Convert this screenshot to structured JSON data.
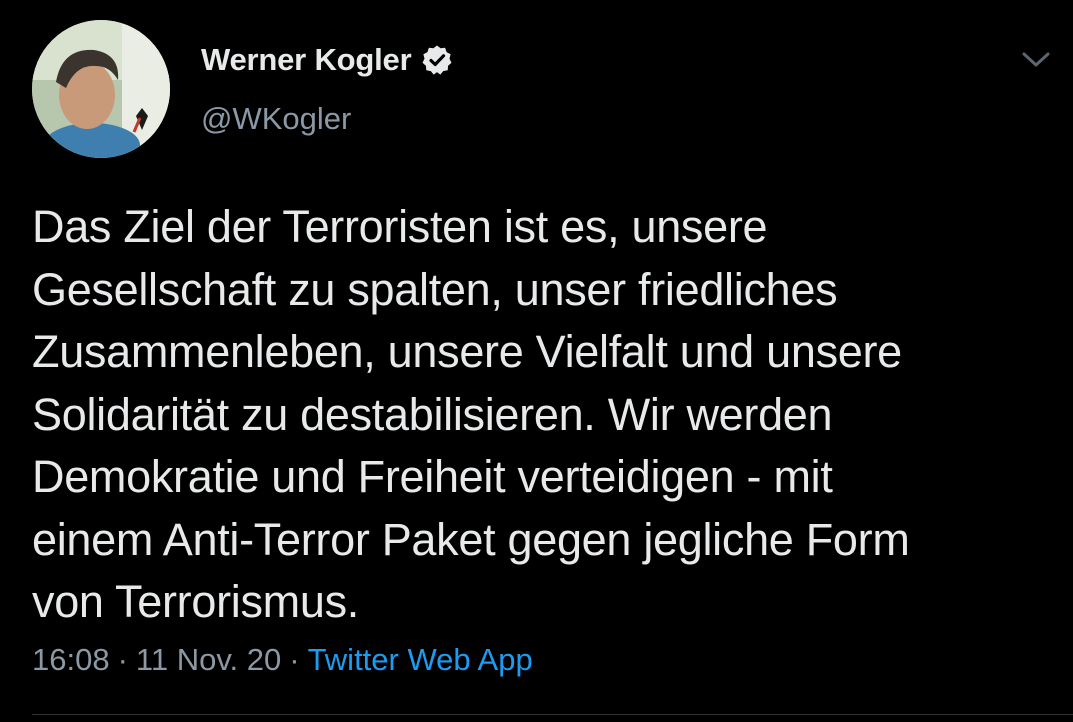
{
  "author": {
    "display_name": "Werner Kogler",
    "handle": "@WKogler",
    "verified": true,
    "avatar_icon": "profile-photo-icon",
    "verified_icon": "verified-badge-icon"
  },
  "menu": {
    "icon": "chevron-down-icon"
  },
  "tweet": {
    "text": "Das Ziel der Terroristen ist es, unsere\nGesellschaft zu spalten, unser friedliches\nZusammenleben, unsere Vielfalt und unsere\nSolidarität zu destabilisieren. Wir werden\nDemokratie und Freiheit verteidigen - mit\neinem Anti-Terror Paket gegen jegliche Form\nvon Terrorismus."
  },
  "meta": {
    "time": "16:08",
    "separator": "·",
    "date": "11 Nov. 20",
    "source": "Twitter Web App"
  },
  "colors": {
    "background": "#000000",
    "text": "#e7e9ea",
    "secondary": "#8b98a5",
    "link": "#1d9bf0"
  }
}
